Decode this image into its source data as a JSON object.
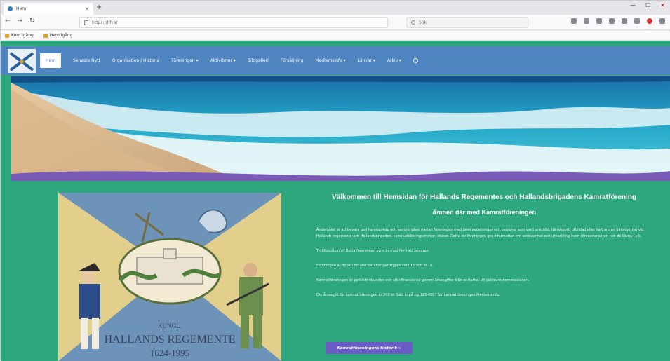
{
  "browser": {
    "tab_title": "Hem",
    "url": "https://hfkar",
    "search_placeholder": "Sök",
    "bookmarks": [
      "Kom igång",
      "Hem igång"
    ]
  },
  "site": {
    "menu": [
      "Hem",
      "Senaste Nytt",
      "Organisation / Historia",
      "Föreningen ▾",
      "Aktiviteter ▾",
      "Bildgalleri",
      "Försäljning",
      "Medlemsinfo ▾",
      "Länkar ▾",
      "Arkiv ▾"
    ],
    "poster": {
      "line1": "KUNGL.",
      "line2": "HALLANDS REGEMENTE",
      "line3": "1624-1995"
    },
    "welcome_title": "Välkommen till Hemsidan för Hallands Regementes och Hallandsbrigadens Kamratförening",
    "subheading": "Ämnen där med Kamratföreningen",
    "paragraphs": [
      "Ändamålet är att bevara god kamratskap och samhörighet mellan föreningen med dess avdelningar och personal som varit anställd, tjänstgjort, utbildad eller haft annan tjänstgöring vid Hallands regemente och Hallandsbrigaden, samt utbildningsstyrkor, staber. Detta för föreningen ger information om verksamhet och utveckling inom försvarsmakten och de kärna i.s.k.",
      "Tidtillskottsinfo! Detta föreningen syns är med fler i att bevaras.",
      "Föreningen är öppen för alla som har tjänstgjort vid I 16 och IB 16.",
      "Kamratföreningen är politiskt obunden och självfinansierad genom årsavgifter från anslutna, till jubileumskommissionen.",
      "Din årsavgift för kamratföreningen är 200 kr. Sätt in på bg 123-4567 för kamratföreningen Medlemsinfo."
    ],
    "cta_label": "Kamratföreningens historik »"
  },
  "colors": {
    "menu_bg": "#4f86c2",
    "content_bg": "#2ea77e",
    "cta_bg": "#6a5cc4"
  }
}
